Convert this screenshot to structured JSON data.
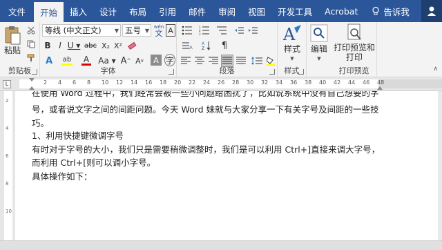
{
  "tabs": {
    "file": "文件",
    "home": "开始",
    "insert": "插入",
    "design": "设计",
    "layout": "布局",
    "references": "引用",
    "mailings": "邮件",
    "review": "审阅",
    "view": "视图",
    "developer": "开发工具",
    "acrobat": "Acrobat",
    "tellme": "告诉我"
  },
  "ribbon": {
    "clipboard": {
      "paste": "粘贴",
      "label": "剪贴板"
    },
    "font": {
      "label": "字体",
      "font_name": "等线 (中文正文)",
      "font_size": "五号",
      "wen": "文"
    },
    "paragraph": {
      "label": "段落"
    },
    "styles": {
      "button": "样式",
      "label": "样式"
    },
    "editing": {
      "button": "编辑"
    },
    "print_preview": {
      "button_line1": "打印预览和",
      "button_line2": "打印",
      "label": "打印预览"
    }
  },
  "ruler": {
    "ticks": [
      "L",
      "2",
      "4",
      "6",
      "8",
      "10",
      "12",
      "14",
      "16",
      "18",
      "20",
      "22",
      "24",
      "26",
      "28",
      "30",
      "32",
      "34",
      "36",
      "38",
      "40",
      "42",
      "44",
      "46",
      "48"
    ]
  },
  "document": {
    "lines": [
      "在使用 Word 过程中，我们经常会被一些小问题给困扰了，比如说系统中没有自己想要的字",
      "号，或者说文字之间的间距问题。今天 Word 妹就与大家分享一下有关字号及间距的一些技",
      "巧。",
      "1、利用快捷键微调字号",
      "有时对于字号的大小，我们只是需要稍微调整时，我们是可以利用  Ctrl+]直接来调大字号，",
      "而利用 Ctrl+[则可以调小字号。",
      "具体操作如下："
    ]
  }
}
